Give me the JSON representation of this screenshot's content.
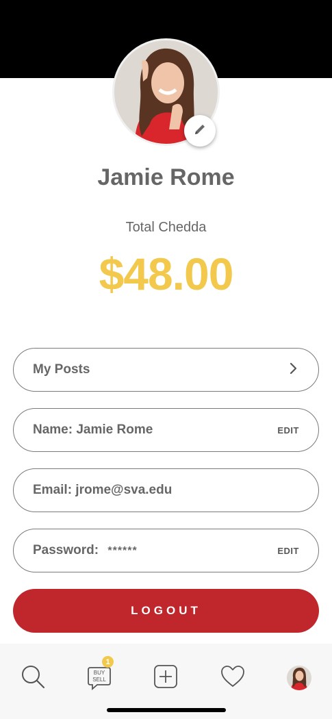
{
  "profile": {
    "name": "Jamie Rome",
    "total_label": "Total Chedda",
    "total_amount": "$48.00"
  },
  "fields": {
    "my_posts": "My Posts",
    "name": "Name: Jamie Rome",
    "name_edit": "EDIT",
    "email": "Email: jrome@sva.edu",
    "password": "Password:",
    "password_value": "******",
    "password_edit": "EDIT"
  },
  "logout_label": "LOGOUT",
  "tabbar": {
    "messages_badge": "1",
    "buy_label": "BUY",
    "sell_label": "SELL",
    "icons": [
      "search-icon",
      "buy-sell-chat-icon",
      "add-icon",
      "heart-icon",
      "profile-avatar"
    ]
  },
  "colors": {
    "accent_yellow": "#f2c94c",
    "logout_red": "#c0272d",
    "header_black": "#000000"
  }
}
